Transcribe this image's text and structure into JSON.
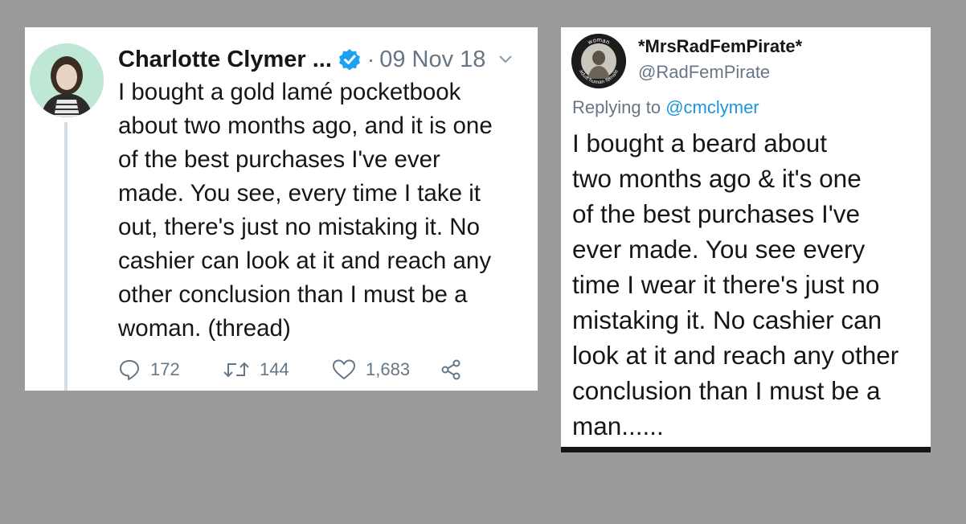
{
  "tweet_left": {
    "display_name": "Charlotte Clymer ...",
    "separator": "·",
    "date": "09 Nov 18",
    "text_lines": [
      "I bought a gold lamé pocketbook",
      "about two months ago, and it is one",
      "of the best purchases I've ever",
      "made. You see, every time I take it",
      "out, there's just no mistaking it. No",
      "cashier can look at it and reach any",
      "other conclusion than I must be a",
      "woman. (thread)"
    ],
    "actions": {
      "replies": "172",
      "retweets": "144",
      "likes": "1,683"
    },
    "icons": {
      "verified": "verified-badge-icon",
      "menu": "chevron-down-icon",
      "reply": "reply-icon",
      "retweet": "retweet-icon",
      "like": "heart-icon",
      "share": "share-icon"
    },
    "colors": {
      "verified": "#1da1f2",
      "muted": "#657786",
      "avatar_bg": "#bfe7d6"
    }
  },
  "tweet_right": {
    "display_name": "*MrsRadFemPirate*",
    "handle": "@RadFemPirate",
    "replying_label": "Replying to",
    "replying_to": "@cmclymer",
    "avatar_text": "woman adult human female",
    "text_lines": [
      "I bought a beard about",
      "two months ago & it's one",
      "of the best purchases I've",
      "ever made. You see every",
      "time I wear it there's just no",
      "mistaking it. No cashier can",
      "look at it and reach any other",
      "conclusion than I must be a",
      "man......"
    ],
    "colors": {
      "mention": "#1b95e0"
    }
  },
  "background_color": "#9a9a9a"
}
